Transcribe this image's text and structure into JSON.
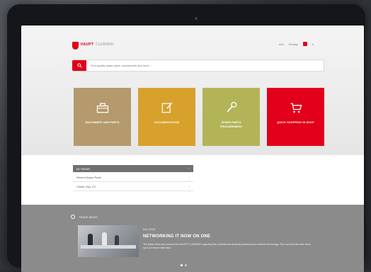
{
  "brand": {
    "name": "HAUPT",
    "tagline": "CLEANING"
  },
  "topnav": {
    "items": [
      "Info",
      "Servisy",
      "0"
    ]
  },
  "search": {
    "placeholder": "Find quality spare parts, accessories and more ..."
  },
  "tiles": [
    {
      "label": "MACHINERY AND PARTS",
      "color": "#b49a6c",
      "icon": "toolbox-icon"
    },
    {
      "label": "DOCUMENTATION",
      "color": "#d8a12c",
      "icon": "document-edit-icon"
    },
    {
      "label": "SPARE PARTS PROCUREMENT",
      "color": "#b3b458",
      "icon": "wrench-icon"
    },
    {
      "label": "QUICK SHOPPING IN SHOP",
      "color": "#e2001a",
      "icon": "shopping-cart-icon"
    }
  ],
  "links_section": {
    "title": "MY NEWS",
    "items": [
      "Recent Spare Parts",
      "Check Your CV"
    ]
  },
  "news": {
    "section_title": "TRADE NEWS",
    "date": "Dec 2018",
    "headline": "NETWORKING IT NOW ON ONE",
    "text": "The latest news and events from HAUPT CLEANING regarding the professional cleaning solutions and machine technology. Find out what we have been up to at recent trade fairs."
  },
  "colors": {
    "accent": "#e2001a",
    "news_bg": "#8b8b8b",
    "section_head": "#707070"
  }
}
